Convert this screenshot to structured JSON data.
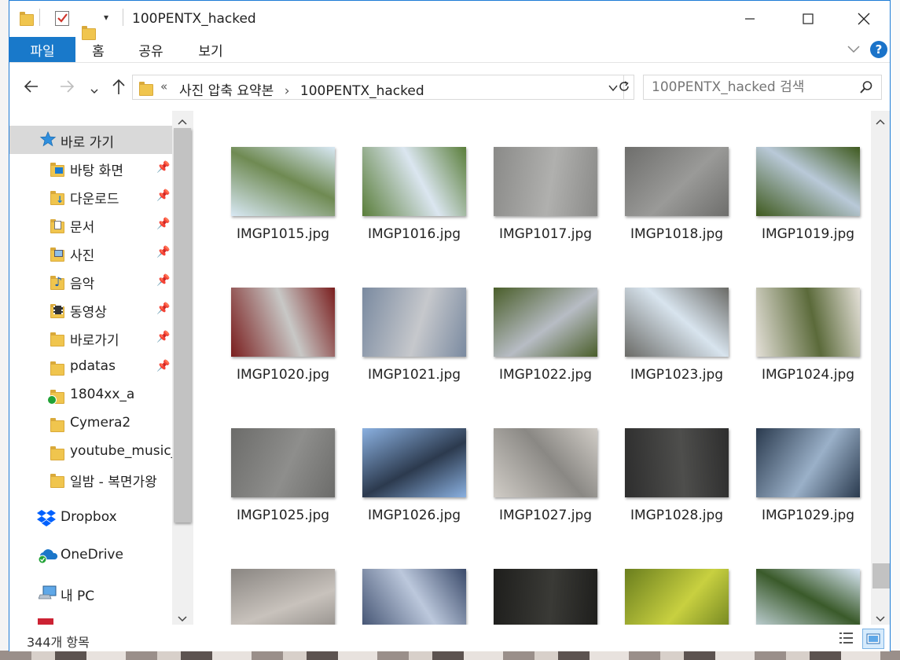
{
  "window": {
    "title": "100PENTX_hacked",
    "controls": {
      "minimize": "—",
      "maximize": "☐",
      "close": "✕"
    }
  },
  "ribbon": {
    "tabs": [
      "파일",
      "홈",
      "공유",
      "보기"
    ],
    "help": "?"
  },
  "address": {
    "prefix": "«",
    "path": [
      "사진 압축 요약본",
      "100PENTX_hacked"
    ],
    "separator": "›"
  },
  "search": {
    "placeholder": "100PENTX_hacked 검색"
  },
  "nav": {
    "quick_access": "바로 가기",
    "pinned": [
      {
        "label": "바탕 화면",
        "icon": "desktop-icon"
      },
      {
        "label": "다운로드",
        "icon": "download-icon"
      },
      {
        "label": "문서",
        "icon": "document-icon"
      },
      {
        "label": "사진",
        "icon": "pictures-icon"
      },
      {
        "label": "음악",
        "icon": "music-icon"
      },
      {
        "label": "동영상",
        "icon": "video-icon"
      },
      {
        "label": "바로가기",
        "icon": "folder-icon"
      },
      {
        "label": "pdatas",
        "icon": "folder-icon"
      }
    ],
    "folders": [
      "1804xx_a",
      "Cymera2",
      "youtube_music_",
      "일밤 - 복면가왕"
    ],
    "dropbox": "Dropbox",
    "onedrive": "OneDrive",
    "this_pc": "내 PC"
  },
  "files": [
    {
      "name": "IMGP1015.jpg",
      "colors": [
        "#d8e8f4",
        "#6f8a52"
      ]
    },
    {
      "name": "IMGP1016.jpg",
      "colors": [
        "#5a7e3a",
        "#dbe6f0"
      ]
    },
    {
      "name": "IMGP1017.jpg",
      "colors": [
        "#8a8a88",
        "#b0b0ae"
      ]
    },
    {
      "name": "IMGP1018.jpg",
      "colors": [
        "#6e6e6c",
        "#9a9a98"
      ]
    },
    {
      "name": "IMGP1019.jpg",
      "colors": [
        "#3f5a1e",
        "#b9c9d8"
      ]
    },
    {
      "name": "IMGP1020.jpg",
      "colors": [
        "#7a1e1e",
        "#c8c8c6"
      ]
    },
    {
      "name": "IMGP1021.jpg",
      "colors": [
        "#7a8aa0",
        "#c6c8cc"
      ]
    },
    {
      "name": "IMGP1022.jpg",
      "colors": [
        "#4a5e2a",
        "#b7bcc4"
      ]
    },
    {
      "name": "IMGP1023.jpg",
      "colors": [
        "#6a6a66",
        "#d8e4ee"
      ]
    },
    {
      "name": "IMGP1024.jpg",
      "colors": [
        "#e4e0d8",
        "#5b6a3a"
      ]
    },
    {
      "name": "IMGP1025.jpg",
      "colors": [
        "#6c6c6a",
        "#8e8e8c"
      ]
    },
    {
      "name": "IMGP1026.jpg",
      "colors": [
        "#8ab0e0",
        "#2c3a4e"
      ]
    },
    {
      "name": "IMGP1027.jpg",
      "colors": [
        "#d0ccc6",
        "#8a8884"
      ]
    },
    {
      "name": "IMGP1028.jpg",
      "colors": [
        "#2e2e2e",
        "#4e4e4c"
      ]
    },
    {
      "name": "IMGP1029.jpg",
      "colors": [
        "#2a3a4e",
        "#9ab0c8"
      ]
    },
    {
      "name": "",
      "colors": [
        "#8a8682",
        "#c8c2bc"
      ]
    },
    {
      "name": "",
      "colors": [
        "#3a4a6a",
        "#bcc8dc"
      ]
    },
    {
      "name": "",
      "colors": [
        "#1e1e1c",
        "#3a3a36"
      ]
    },
    {
      "name": "",
      "colors": [
        "#6a7e1e",
        "#c8d040"
      ]
    },
    {
      "name": "",
      "colors": [
        "#d8e6f4",
        "#3a5a2a"
      ]
    }
  ],
  "status": {
    "count": "344개 항목"
  }
}
